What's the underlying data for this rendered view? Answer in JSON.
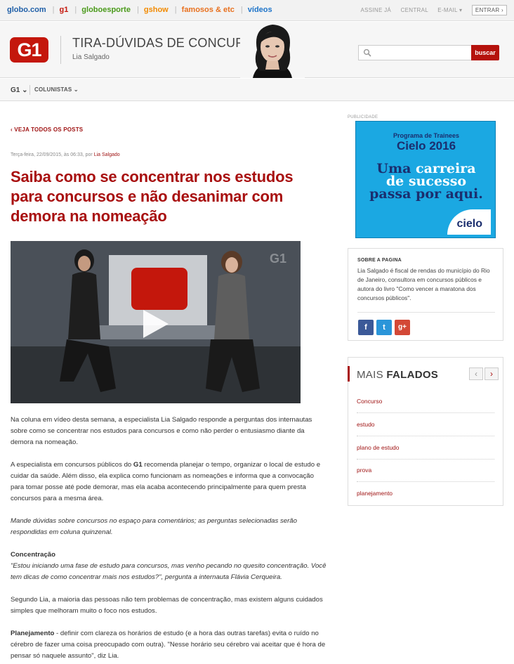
{
  "globobar": {
    "links": [
      {
        "label": "globo.com",
        "color": "#1f5fa8"
      },
      {
        "label": "g1",
        "color": "#c4170c"
      },
      {
        "label": "globoesporte",
        "color": "#4a9a1a"
      },
      {
        "label": "gshow",
        "color": "#f28a00"
      },
      {
        "label": "famosos & etc",
        "color": "#e8701e"
      },
      {
        "label": "vídeos",
        "color": "#1e74c9"
      }
    ],
    "right": {
      "assine": "ASSINE JÁ",
      "central": "CENTRAL",
      "email": "E-MAIL ▾",
      "entrar": "ENTRAR ›"
    }
  },
  "header": {
    "logo": "G1",
    "title": "TIRA-DÚVIDAS DE CONCURSOS",
    "author": "Lia Salgado",
    "search_button": "buscar"
  },
  "subnav": {
    "g1": "G1 ⌄",
    "colunistas": "COLUNISTAS ⌄"
  },
  "post": {
    "back_link": "‹  VEJA TODOS OS POSTS",
    "meta_date": "Terça-feira, 22/09/2015, às 06:33, por ",
    "meta_author": "Lia Salgado",
    "headline": "Saiba como se concentrar nos estudos para concursos e não desanimar com demora na nomeação",
    "video_watermark": "G1",
    "paragraphs": {
      "p1": "Na coluna em vídeo desta semana, a especialista Lia Salgado responde a perguntas dos internautas sobre como se concentrar nos estudos para concursos e como não perder o entusiasmo diante da demora na nomeação.",
      "p2a": "A especialista em concursos públicos do ",
      "p2b": "G1",
      "p2c": " recomenda planejar o tempo, organizar o local de estudo e cuidar da saúde. Além disso, ela explica como funcionam as nomeações e informa que a convocação para tomar posse até pode demorar, mas ela acaba acontecendo principalmente para quem presta concursos para a mesma área.",
      "p3": "Mande dúvidas sobre concursos no espaço para comentários; as perguntas selecionadas serão respondidas em coluna quinzenal.",
      "p4h": "Concentração",
      "p4": "\"Estou iniciando uma fase de estudo para concursos, mas venho pecando no quesito concentração. Você tem dicas de como concentrar mais nos estudos?\", pergunta a internauta Flávia Cerqueira.",
      "p5": "Segundo Lia, a maioria das pessoas não tem problemas de concentração, mas existem alguns cuidados simples que melhoram muito o foco nos estudos.",
      "p6h": "Planejamento",
      "p6": " - definir com clareza os horários de estudo (e a hora das outras tarefas) evita o ruído no cérebro de fazer uma coisa preocupado com outra). \"Nesse horário seu cérebro vai aceitar que é hora de pensar só naquele assunto\", diz Lia."
    }
  },
  "sidebar": {
    "pub_label": "PUBLICIDADE",
    "ad": {
      "subtitle": "Programa de Trainees",
      "year": "Cielo 2016",
      "line1a": "Uma ",
      "line1b": "carreira",
      "line2": "de sucesso",
      "line3": "passa por aqui.",
      "brand": "cielo"
    },
    "about": {
      "heading": "SOBRE A PAGINA",
      "text": "Lia Salgado é fiscal de rendas do município do Rio de Janeiro, consultora em concursos públicos e autora do livro \"Como vencer a maratona dos concursos públicos\"."
    },
    "social": {
      "fb": "f",
      "tw": "t",
      "gp": "g+"
    },
    "mais": {
      "title_a": "MAIS ",
      "title_b": "FALADOS",
      "prev": "‹",
      "next": "›",
      "items": [
        "Concurso",
        "estudo",
        "plano de estudo",
        "prova",
        "planejamento"
      ]
    }
  }
}
